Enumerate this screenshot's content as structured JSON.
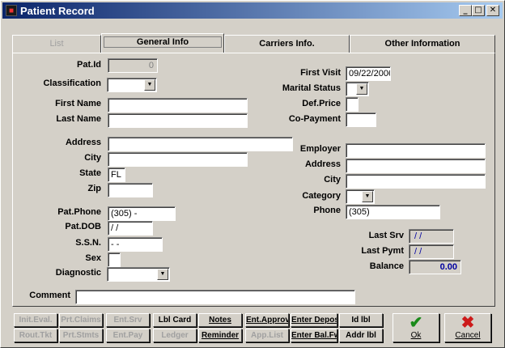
{
  "window": {
    "title": "Patient Record",
    "icon": "app-icon"
  },
  "tabs": [
    {
      "label": "List",
      "state": "disabled"
    },
    {
      "label": "General Info",
      "state": "active"
    },
    {
      "label": "Carriers Info.",
      "state": "normal"
    },
    {
      "label": "Other Information",
      "state": "normal"
    }
  ],
  "form": {
    "pat_id": {
      "label": "Pat.Id",
      "value": "0"
    },
    "classification": {
      "label": "Classification",
      "value": ""
    },
    "first_name": {
      "label": "First Name",
      "value": ""
    },
    "last_name": {
      "label": "Last Name",
      "value": ""
    },
    "address": {
      "label": "Address",
      "value": ""
    },
    "city": {
      "label": "City",
      "value": ""
    },
    "state": {
      "label": "State",
      "value": "FL"
    },
    "zip": {
      "label": "Zip",
      "value": ""
    },
    "pat_phone": {
      "label": "Pat.Phone",
      "value": "(305)   -"
    },
    "pat_dob": {
      "label": "Pat.DOB",
      "value": " / /"
    },
    "ssn": {
      "label": "S.S.N.",
      "value": "  - -"
    },
    "sex": {
      "label": "Sex",
      "value": ""
    },
    "diagnostic": {
      "label": "Diagnostic",
      "value": ""
    },
    "first_visit": {
      "label": "First Visit",
      "value": "09/22/2006"
    },
    "marital_status": {
      "label": "Marital Status",
      "value": ""
    },
    "def_price": {
      "label": "Def.Price",
      "value": ""
    },
    "co_payment": {
      "label": "Co-Payment",
      "value": ""
    },
    "employer": {
      "label": "Employer",
      "value": ""
    },
    "emp_address": {
      "label": "Address",
      "value": ""
    },
    "emp_city": {
      "label": "City",
      "value": ""
    },
    "category": {
      "label": "Category",
      "value": ""
    },
    "phone": {
      "label": "Phone",
      "value": "(305)"
    },
    "last_srv": {
      "label": "Last Srv",
      "value": "/ /"
    },
    "last_pymt": {
      "label": "Last Pymt",
      "value": "/ /"
    },
    "balance": {
      "label": "Balance",
      "value": "0.00"
    },
    "comment": {
      "label": "Comment",
      "value": ""
    }
  },
  "buttons": {
    "row1": [
      {
        "label": "Init.Eval.",
        "enabled": false
      },
      {
        "label": "Prt.Claims",
        "enabled": false
      },
      {
        "label": "Ent.Srv",
        "enabled": false
      },
      {
        "label": "Lbl Card",
        "enabled": true
      },
      {
        "label": "Notes",
        "enabled": true
      },
      {
        "label": "Ent.Approv",
        "enabled": true
      },
      {
        "label": "Enter Depos",
        "enabled": true
      },
      {
        "label": "Id lbl",
        "enabled": true
      }
    ],
    "row2": [
      {
        "label": "Rout.Tkt",
        "enabled": false
      },
      {
        "label": "Prt.Stmts",
        "enabled": false
      },
      {
        "label": "Ent.Pay",
        "enabled": false
      },
      {
        "label": "Ledger",
        "enabled": false
      },
      {
        "label": "Reminder",
        "enabled": true
      },
      {
        "label": "App.List",
        "enabled": false
      },
      {
        "label": "Enter Bal.Fw",
        "enabled": true
      },
      {
        "label": "Addr lbl",
        "enabled": true
      }
    ],
    "ok": {
      "label": "Ok",
      "icon": "checkmark-icon",
      "color": "#1a8a1a"
    },
    "cancel": {
      "label": "Cancel",
      "icon": "x-icon",
      "color": "#cc1a1a"
    }
  }
}
